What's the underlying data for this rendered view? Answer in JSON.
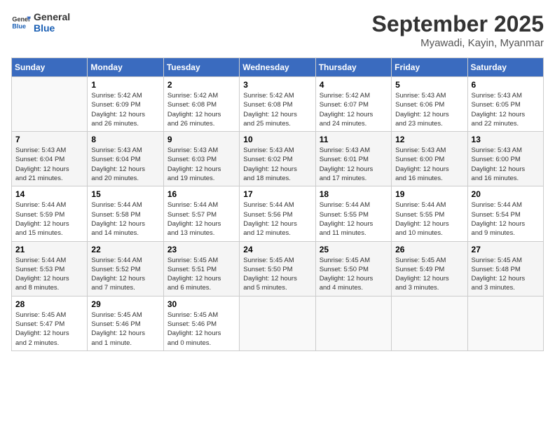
{
  "logo": {
    "line1": "General",
    "line2": "Blue"
  },
  "title": "September 2025",
  "subtitle": "Myawadi, Kayin, Myanmar",
  "days_of_week": [
    "Sunday",
    "Monday",
    "Tuesday",
    "Wednesday",
    "Thursday",
    "Friday",
    "Saturday"
  ],
  "weeks": [
    [
      {
        "day": "",
        "info": ""
      },
      {
        "day": "1",
        "info": "Sunrise: 5:42 AM\nSunset: 6:09 PM\nDaylight: 12 hours\nand 26 minutes."
      },
      {
        "day": "2",
        "info": "Sunrise: 5:42 AM\nSunset: 6:08 PM\nDaylight: 12 hours\nand 26 minutes."
      },
      {
        "day": "3",
        "info": "Sunrise: 5:42 AM\nSunset: 6:08 PM\nDaylight: 12 hours\nand 25 minutes."
      },
      {
        "day": "4",
        "info": "Sunrise: 5:42 AM\nSunset: 6:07 PM\nDaylight: 12 hours\nand 24 minutes."
      },
      {
        "day": "5",
        "info": "Sunrise: 5:43 AM\nSunset: 6:06 PM\nDaylight: 12 hours\nand 23 minutes."
      },
      {
        "day": "6",
        "info": "Sunrise: 5:43 AM\nSunset: 6:05 PM\nDaylight: 12 hours\nand 22 minutes."
      }
    ],
    [
      {
        "day": "7",
        "info": "Sunrise: 5:43 AM\nSunset: 6:04 PM\nDaylight: 12 hours\nand 21 minutes."
      },
      {
        "day": "8",
        "info": "Sunrise: 5:43 AM\nSunset: 6:04 PM\nDaylight: 12 hours\nand 20 minutes."
      },
      {
        "day": "9",
        "info": "Sunrise: 5:43 AM\nSunset: 6:03 PM\nDaylight: 12 hours\nand 19 minutes."
      },
      {
        "day": "10",
        "info": "Sunrise: 5:43 AM\nSunset: 6:02 PM\nDaylight: 12 hours\nand 18 minutes."
      },
      {
        "day": "11",
        "info": "Sunrise: 5:43 AM\nSunset: 6:01 PM\nDaylight: 12 hours\nand 17 minutes."
      },
      {
        "day": "12",
        "info": "Sunrise: 5:43 AM\nSunset: 6:00 PM\nDaylight: 12 hours\nand 16 minutes."
      },
      {
        "day": "13",
        "info": "Sunrise: 5:43 AM\nSunset: 6:00 PM\nDaylight: 12 hours\nand 16 minutes."
      }
    ],
    [
      {
        "day": "14",
        "info": "Sunrise: 5:44 AM\nSunset: 5:59 PM\nDaylight: 12 hours\nand 15 minutes."
      },
      {
        "day": "15",
        "info": "Sunrise: 5:44 AM\nSunset: 5:58 PM\nDaylight: 12 hours\nand 14 minutes."
      },
      {
        "day": "16",
        "info": "Sunrise: 5:44 AM\nSunset: 5:57 PM\nDaylight: 12 hours\nand 13 minutes."
      },
      {
        "day": "17",
        "info": "Sunrise: 5:44 AM\nSunset: 5:56 PM\nDaylight: 12 hours\nand 12 minutes."
      },
      {
        "day": "18",
        "info": "Sunrise: 5:44 AM\nSunset: 5:55 PM\nDaylight: 12 hours\nand 11 minutes."
      },
      {
        "day": "19",
        "info": "Sunrise: 5:44 AM\nSunset: 5:55 PM\nDaylight: 12 hours\nand 10 minutes."
      },
      {
        "day": "20",
        "info": "Sunrise: 5:44 AM\nSunset: 5:54 PM\nDaylight: 12 hours\nand 9 minutes."
      }
    ],
    [
      {
        "day": "21",
        "info": "Sunrise: 5:44 AM\nSunset: 5:53 PM\nDaylight: 12 hours\nand 8 minutes."
      },
      {
        "day": "22",
        "info": "Sunrise: 5:44 AM\nSunset: 5:52 PM\nDaylight: 12 hours\nand 7 minutes."
      },
      {
        "day": "23",
        "info": "Sunrise: 5:45 AM\nSunset: 5:51 PM\nDaylight: 12 hours\nand 6 minutes."
      },
      {
        "day": "24",
        "info": "Sunrise: 5:45 AM\nSunset: 5:50 PM\nDaylight: 12 hours\nand 5 minutes."
      },
      {
        "day": "25",
        "info": "Sunrise: 5:45 AM\nSunset: 5:50 PM\nDaylight: 12 hours\nand 4 minutes."
      },
      {
        "day": "26",
        "info": "Sunrise: 5:45 AM\nSunset: 5:49 PM\nDaylight: 12 hours\nand 3 minutes."
      },
      {
        "day": "27",
        "info": "Sunrise: 5:45 AM\nSunset: 5:48 PM\nDaylight: 12 hours\nand 3 minutes."
      }
    ],
    [
      {
        "day": "28",
        "info": "Sunrise: 5:45 AM\nSunset: 5:47 PM\nDaylight: 12 hours\nand 2 minutes."
      },
      {
        "day": "29",
        "info": "Sunrise: 5:45 AM\nSunset: 5:46 PM\nDaylight: 12 hours\nand 1 minute."
      },
      {
        "day": "30",
        "info": "Sunrise: 5:45 AM\nSunset: 5:46 PM\nDaylight: 12 hours\nand 0 minutes."
      },
      {
        "day": "",
        "info": ""
      },
      {
        "day": "",
        "info": ""
      },
      {
        "day": "",
        "info": ""
      },
      {
        "day": "",
        "info": ""
      }
    ]
  ]
}
